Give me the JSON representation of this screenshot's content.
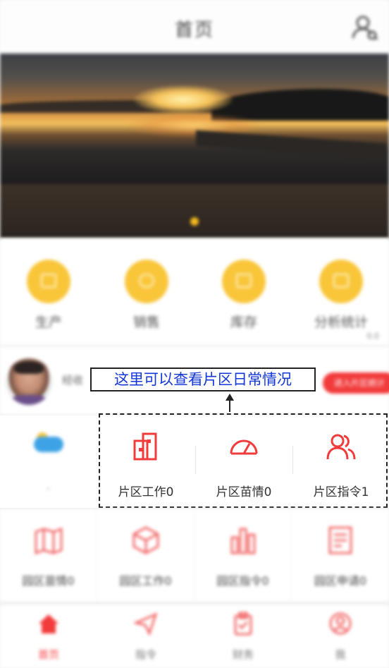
{
  "header": {
    "title": "首页",
    "user_icon": "users-icon"
  },
  "banner": {
    "carousel_dots": 1,
    "active_dot": 1
  },
  "menu": {
    "items": [
      {
        "label": "生产",
        "icon": "production-icon"
      },
      {
        "label": "销售",
        "icon": "sales-icon"
      },
      {
        "label": "库存",
        "icon": "inventory-icon"
      },
      {
        "label": "分析统计",
        "icon": "statistics-icon"
      }
    ],
    "tiny_text": "0.0"
  },
  "profile": {
    "name": "经收",
    "action_label": "进入片区统计"
  },
  "callout": {
    "text": "这里可以查看片区日常情况"
  },
  "weather": {
    "value": "-"
  },
  "region": {
    "items": [
      {
        "label": "片区工作0",
        "icon": "building-icon"
      },
      {
        "label": "片区苗情0",
        "icon": "gauge-icon"
      },
      {
        "label": "片区指令1",
        "icon": "people-icon"
      }
    ]
  },
  "park": {
    "items": [
      {
        "label": "园区苗情0",
        "icon": "map-icon"
      },
      {
        "label": "园区工作0",
        "icon": "box-icon"
      },
      {
        "label": "园区指令0",
        "icon": "chart-bars-icon"
      },
      {
        "label": "园区申请0",
        "icon": "document-icon"
      }
    ]
  },
  "tabbar": {
    "items": [
      {
        "label": "首页",
        "icon": "home-icon",
        "active": true
      },
      {
        "label": "指令",
        "icon": "send-icon",
        "active": false
      },
      {
        "label": "财务",
        "icon": "clipboard-icon",
        "active": false
      },
      {
        "label": "我",
        "icon": "person-icon",
        "active": false
      }
    ]
  },
  "colors": {
    "accent_red": "#f23b3b",
    "menu_yellow": "#f9c63a",
    "callout_text": "#1336d6"
  }
}
